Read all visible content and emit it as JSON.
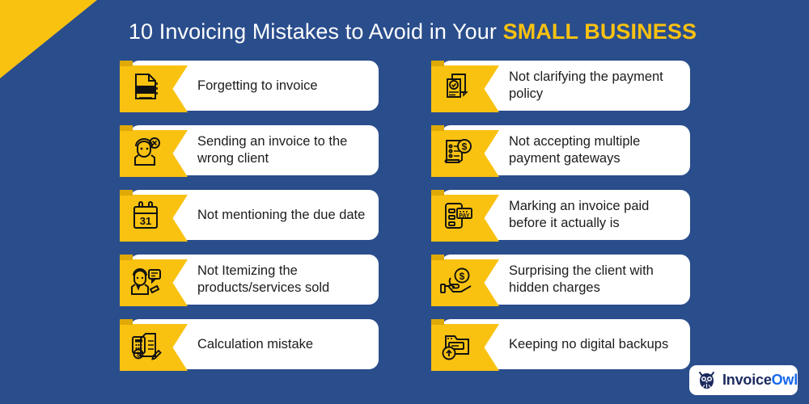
{
  "theme": {
    "background": "#2a4d8c",
    "accent_yellow": "#f9c211",
    "card_background": "#ffffff",
    "text_dark": "#1c1c1c",
    "text_light": "#ffffff",
    "logo_navy": "#1b2a5e",
    "logo_blue": "#1668f0"
  },
  "headline": {
    "prefix": "10 Invoicing Mistakes to Avoid in Your ",
    "accent": "SMALL BUSINESS"
  },
  "columns": {
    "left": [
      {
        "label": "Forgetting to invoice",
        "icon": "invoice-document-icon"
      },
      {
        "label": "Sending an invoice to the wrong client",
        "icon": "wrong-client-icon"
      },
      {
        "label": "Not mentioning the due date",
        "icon": "calendar-31-icon"
      },
      {
        "label": "Not Itemizing the products/services sold",
        "icon": "agent-chat-icon"
      },
      {
        "label": "Calculation mistake",
        "icon": "calculator-invoice-icon"
      }
    ],
    "right": [
      {
        "label": "Not clarifying the payment policy",
        "icon": "policy-check-icon"
      },
      {
        "label": "Not accepting multiple payment gateways",
        "icon": "payment-gateway-icon"
      },
      {
        "label": "Marking an invoice paid before it actually is",
        "icon": "mobile-pay-icon"
      },
      {
        "label": "Surprising the client with hidden charges",
        "icon": "hand-coin-icon"
      },
      {
        "label": "Keeping no digital backups",
        "icon": "folder-backup-icon"
      }
    ]
  },
  "calendar_icon_day": "31",
  "pay_icon_label": "PAY",
  "invoice_icon_label": "INVOICE",
  "logo": {
    "word_one": "Invoice",
    "word_two": "Owl",
    "mark": "owl-icon"
  }
}
